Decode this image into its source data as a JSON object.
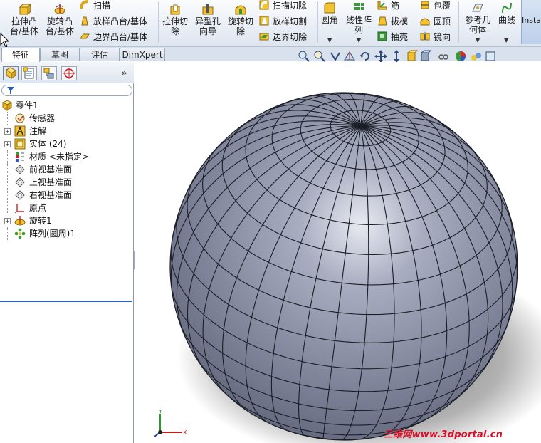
{
  "ribbon": {
    "extrude_boss": [
      "拉伸凸",
      "台/基体"
    ],
    "revolve_boss": [
      "旋转凸",
      "台/基体"
    ],
    "sweep": "扫描",
    "loft_boss": "放样凸台/基体",
    "boundary_boss": "边界凸台/基体",
    "extrude_cut": [
      "拉伸切",
      "除"
    ],
    "hole_wizard": [
      "异型孔",
      "向导"
    ],
    "revolve_cut": [
      "旋转切",
      "除"
    ],
    "sweep_cut": "扫描切除",
    "loft_cut": "放样切割",
    "boundary_cut": "边界切除",
    "fillet": "圆角",
    "linear_pattern": [
      "线性阵",
      "列"
    ],
    "rib": "筋",
    "draft": "拔模",
    "shell": "抽壳",
    "wrap": "包覆",
    "dome": "圆顶",
    "mirror": "镜向",
    "ref_geometry": [
      "参考几",
      "何体"
    ],
    "curves": "曲线",
    "instant3d": "Insta"
  },
  "tabs": [
    "特征",
    "草图",
    "评估",
    "DimXpert"
  ],
  "tree": {
    "root": "零件1",
    "items": [
      {
        "label": "传感器",
        "icon": "sensor-icon",
        "expandable": false
      },
      {
        "label": "注解",
        "icon": "annotation-icon",
        "expandable": true
      },
      {
        "label": "实体 (24)",
        "icon": "solid-bodies-icon",
        "expandable": true
      },
      {
        "label": "材质 <未指定>",
        "icon": "material-icon",
        "expandable": false
      },
      {
        "label": "前视基准面",
        "icon": "plane-icon",
        "expandable": false
      },
      {
        "label": "上视基准面",
        "icon": "plane-icon",
        "expandable": false
      },
      {
        "label": "右视基准面",
        "icon": "plane-icon",
        "expandable": false
      },
      {
        "label": "原点",
        "icon": "origin-icon",
        "expandable": false
      },
      {
        "label": "旋转1",
        "icon": "revolve-icon",
        "expandable": true
      },
      {
        "label": "阵列(圆周)1",
        "icon": "circular-pattern-icon",
        "expandable": false
      }
    ]
  },
  "triad": {
    "y": "Y",
    "x": "X"
  },
  "watermark": "三维网www.3dportal.cn",
  "colors": {
    "sphere": "#8f93a8",
    "accent": "#2b5cc4",
    "watermark": "#d8102a"
  }
}
